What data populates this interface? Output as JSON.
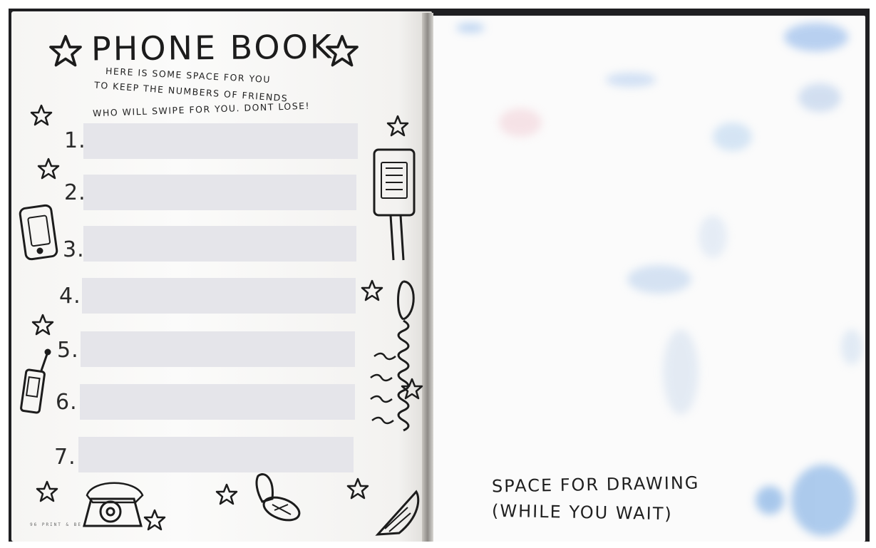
{
  "page": {
    "title": "PHONE BOOK",
    "intro_lines": [
      "HERE IS SOME SPACE FOR YOU",
      "TO KEEP THE NUMBERS OF FRIENDS",
      "WHO WILL SWIPE FOR YOU. DONT LOSE!"
    ],
    "entries": [
      "1.",
      "2.",
      "3.",
      "4.",
      "5.",
      "6.",
      "7."
    ],
    "footer_small": "96   PRINT & BE...",
    "drawing_caption_lines": [
      "SPACE FOR DRAWING",
      "(WHILE YOU WAIT)"
    ]
  },
  "colors": {
    "ink": "#1c1c1c",
    "entry_fill": "#e5e5ea",
    "watercolor_blue": "#9ec3ea",
    "watercolor_pink": "#f0c8cf",
    "background": "#1f1f22"
  },
  "icons": [
    "star-icon",
    "mobile-phone-icon",
    "payphone-icon",
    "handset-cord-icon",
    "cordless-phone-icon",
    "rotary-phone-icon",
    "flip-phone-icon"
  ]
}
